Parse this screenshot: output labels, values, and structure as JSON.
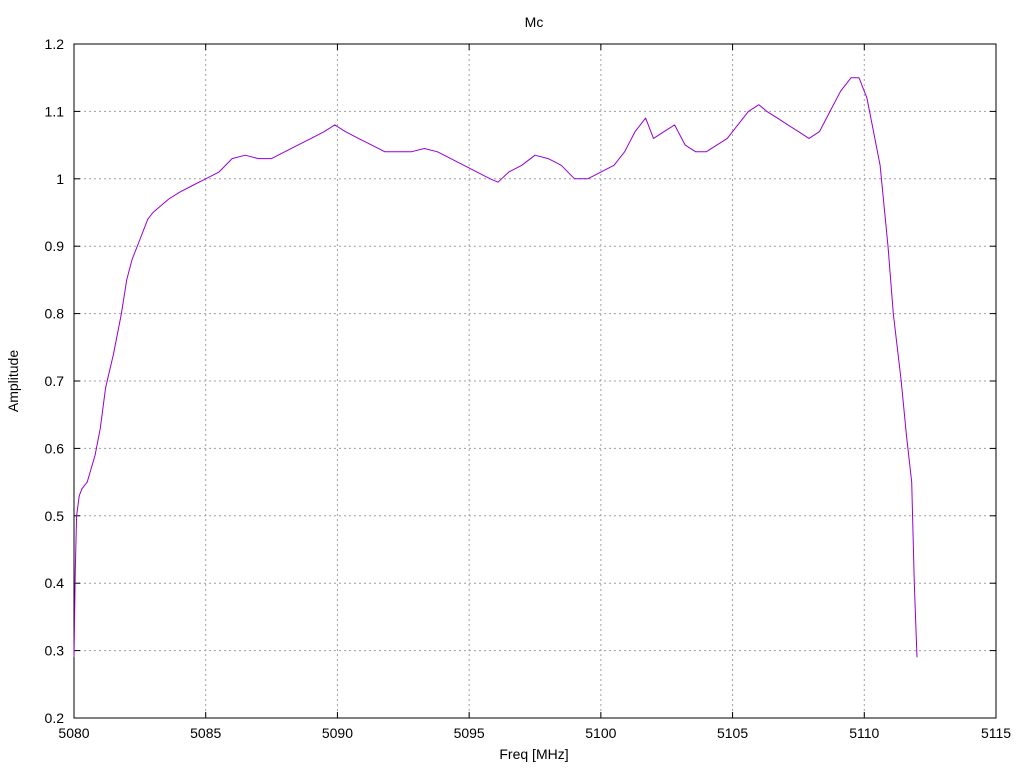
{
  "chart_data": {
    "type": "line",
    "title": "Mc",
    "xlabel": "Freq [MHz]",
    "ylabel": "Amplitude",
    "xlim": [
      5080,
      5115
    ],
    "ylim": [
      0.2,
      1.2
    ],
    "xticks": [
      5080,
      5085,
      5090,
      5095,
      5100,
      5105,
      5110,
      5115
    ],
    "yticks": [
      0.2,
      0.3,
      0.4,
      0.5,
      0.6,
      0.7,
      0.8,
      0.9,
      1.0,
      1.1,
      1.2
    ],
    "xtick_labels": [
      "5080",
      "5085",
      "5090",
      "5095",
      "5100",
      "5105",
      "5110",
      "5115"
    ],
    "ytick_labels": [
      "0.2",
      "0.3",
      "0.4",
      "0.5",
      "0.6",
      "0.7",
      "0.8",
      "0.9",
      "1",
      "1.1",
      "1.2"
    ],
    "grid": true,
    "series": [
      {
        "color": "#9400d3",
        "x": [
          5080.0,
          5080.05,
          5080.1,
          5080.2,
          5080.3,
          5080.5,
          5080.8,
          5081.0,
          5081.2,
          5081.5,
          5081.8,
          5082.0,
          5082.2,
          5082.5,
          5082.8,
          5083.0,
          5083.3,
          5083.6,
          5084.0,
          5084.5,
          5085.0,
          5085.5,
          5086.0,
          5086.5,
          5087.0,
          5087.5,
          5088.0,
          5088.5,
          5089.0,
          5089.5,
          5089.9,
          5090.3,
          5090.8,
          5091.3,
          5091.8,
          5092.3,
          5092.8,
          5093.3,
          5093.8,
          5094.3,
          5094.8,
          5095.3,
          5095.8,
          5096.1,
          5096.5,
          5097.0,
          5097.5,
          5098.0,
          5098.5,
          5099.0,
          5099.5,
          5100.0,
          5100.5,
          5100.9,
          5101.3,
          5101.7,
          5102.0,
          5102.4,
          5102.8,
          5103.2,
          5103.6,
          5104.0,
          5104.4,
          5104.8,
          5105.2,
          5105.6,
          5106.0,
          5106.3,
          5106.7,
          5107.1,
          5107.5,
          5107.9,
          5108.3,
          5108.7,
          5109.1,
          5109.5,
          5109.8,
          5110.1,
          5110.3,
          5110.6,
          5110.9,
          5111.1,
          5111.4,
          5111.6,
          5111.8,
          5111.9,
          5112.0
        ],
        "y": [
          0.29,
          0.42,
          0.5,
          0.53,
          0.54,
          0.55,
          0.59,
          0.63,
          0.69,
          0.74,
          0.8,
          0.85,
          0.88,
          0.91,
          0.94,
          0.95,
          0.96,
          0.97,
          0.98,
          0.99,
          1.0,
          1.01,
          1.03,
          1.035,
          1.03,
          1.03,
          1.04,
          1.05,
          1.06,
          1.07,
          1.08,
          1.07,
          1.06,
          1.05,
          1.04,
          1.04,
          1.04,
          1.045,
          1.04,
          1.03,
          1.02,
          1.01,
          1.0,
          0.995,
          1.01,
          1.02,
          1.035,
          1.03,
          1.02,
          1.0,
          1.0,
          1.01,
          1.02,
          1.04,
          1.07,
          1.09,
          1.06,
          1.07,
          1.08,
          1.05,
          1.04,
          1.04,
          1.05,
          1.06,
          1.08,
          1.1,
          1.11,
          1.1,
          1.09,
          1.08,
          1.07,
          1.06,
          1.07,
          1.1,
          1.13,
          1.15,
          1.15,
          1.12,
          1.08,
          1.02,
          0.9,
          0.8,
          0.7,
          0.62,
          0.55,
          0.4,
          0.29
        ]
      }
    ]
  }
}
